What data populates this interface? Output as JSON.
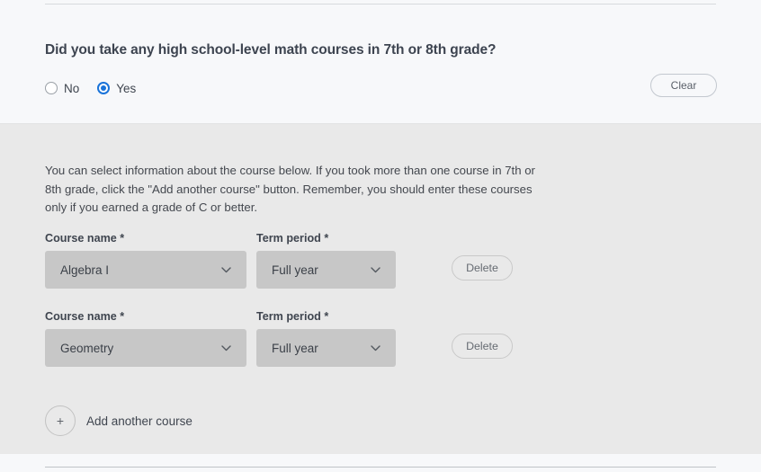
{
  "accent_colors": {
    "edge_accent": "#e3c96a",
    "radio_selected": "#1a73d9",
    "panel_background": "#e9e9e9",
    "page_background": "#f7f8fa",
    "select_background": "#c7c7c7"
  },
  "question": {
    "title": "Did you take any high school-level math courses in 7th or 8th grade?",
    "options": [
      {
        "label": "No",
        "selected": false
      },
      {
        "label": "Yes",
        "selected": true
      }
    ],
    "clear_label": "Clear"
  },
  "panel": {
    "intro": "You can select information about the course below. If you took more than one course in 7th or 8th grade, click the \"Add another course\" button. Remember, you should enter these courses only if you earned a grade of C or better.",
    "labels": {
      "course_name": "Course name *",
      "term_period": "Term period *",
      "delete": "Delete"
    },
    "rows": [
      {
        "course_name": "Algebra I",
        "term_period": "Full year",
        "delete_label": "Delete"
      },
      {
        "course_name": "Geometry",
        "term_period": "Full year",
        "delete_label": "Delete"
      }
    ],
    "add_course": {
      "icon_label": "+",
      "label": "Add another course"
    }
  }
}
